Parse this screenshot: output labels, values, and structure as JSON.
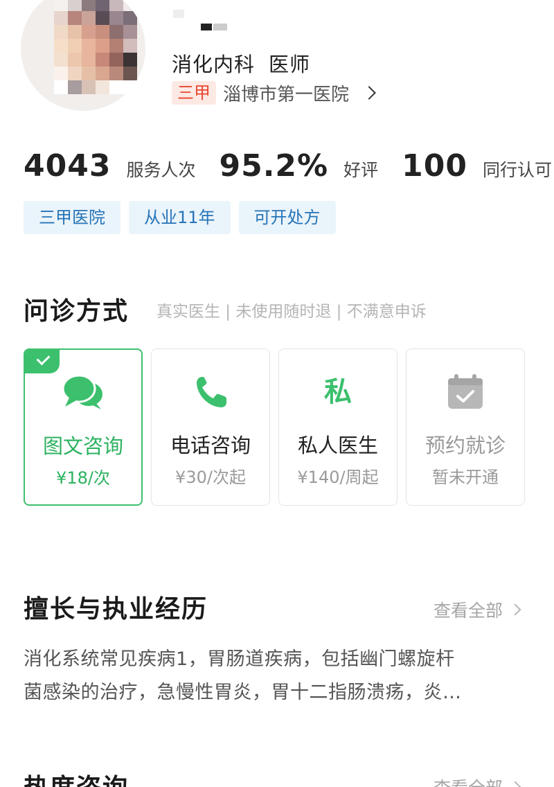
{
  "doctor": {
    "department": "消化内科",
    "title": "医师",
    "hospital_grade": "三甲",
    "hospital_name": "淄博市第一医院"
  },
  "stats": [
    {
      "value": "4043",
      "label": "服务人次"
    },
    {
      "value": "95.2%",
      "label": "好评"
    },
    {
      "value": "100",
      "label": "同行认可"
    }
  ],
  "tags": [
    "三甲医院",
    "从业11年",
    "可开处方"
  ],
  "consult": {
    "title": "问诊方式",
    "subtitle": "真实医生 | 未使用随时退 | 不满意申诉",
    "options": [
      {
        "label": "图文咨询",
        "price": "¥18/次",
        "icon": "chat-bubbles-icon",
        "selected": true
      },
      {
        "label": "电话咨询",
        "price": "¥30/次起",
        "icon": "phone-icon",
        "selected": false
      },
      {
        "label": "私人医生",
        "price": "¥140/周起",
        "icon": "private-doctor-icon",
        "icon_text": "私",
        "selected": false
      },
      {
        "label": "预约就诊",
        "price": "暂未开通",
        "icon": "calendar-check-icon",
        "selected": false
      }
    ],
    "colors": {
      "accent": "#3cc06d",
      "disabled": "#b7b7b7"
    }
  },
  "experience": {
    "title": "擅长与执业经历",
    "view_all": "查看全部",
    "line1": "消化系统常见疾病1，胃肠道疾病，包括幽门螺旋杆",
    "line2": "菌感染的治疗，急慢性胃炎，胃十二指肠溃疡，炎…"
  },
  "hot": {
    "title": "热度咨询",
    "view_all": "查看全部"
  }
}
